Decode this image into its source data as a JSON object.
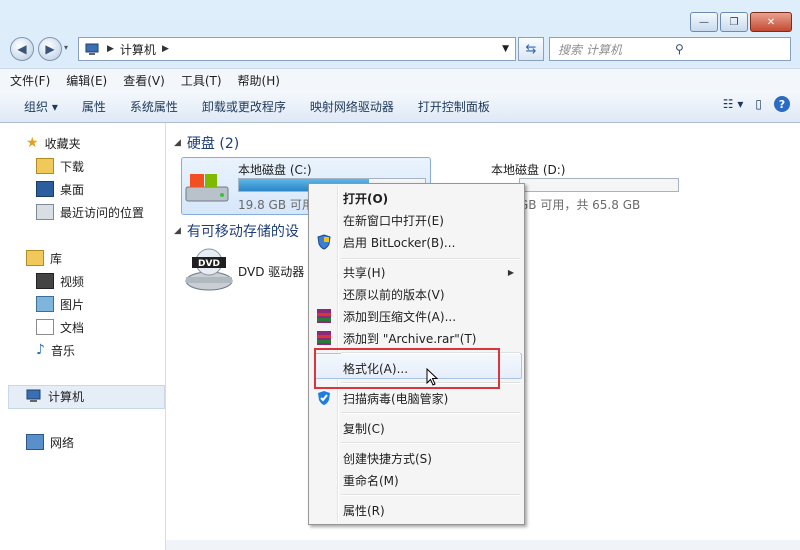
{
  "window": {
    "buttons": {
      "minimize": "—",
      "maximize": "❐",
      "close": "✕"
    }
  },
  "address": {
    "path": "计算机",
    "search_placeholder": "搜索 计算机"
  },
  "menubar": [
    "文件(F)",
    "编辑(E)",
    "查看(V)",
    "工具(T)",
    "帮助(H)"
  ],
  "toolbar": {
    "organize": "组织 ▾",
    "items": [
      "属性",
      "系统属性",
      "卸载或更改程序",
      "映射网络驱动器",
      "打开控制面板"
    ]
  },
  "nav": {
    "favorites": "收藏夹",
    "fav_items": [
      "下载",
      "桌面",
      "最近访问的位置"
    ],
    "library": "库",
    "lib_items": [
      "视频",
      "图片",
      "文档",
      "音乐"
    ],
    "computer": "计算机",
    "network": "网络"
  },
  "content": {
    "hard_disks": "硬盘 (2)",
    "removable": "有可移动存储的设",
    "drive_c": {
      "name": "本地磁盘 (C:)",
      "info": "19.8 GB 可用",
      "used_fraction": 0.7
    },
    "drive_d": {
      "name": "本地磁盘 (D:)",
      "info": "GB 可用，共 65.8 GB",
      "used_fraction": 0.0
    },
    "dvd": {
      "name": "DVD 驱动器",
      "badge": "DVD"
    }
  },
  "context_menu": {
    "open": "打开(O)",
    "open_new": "在新窗口中打开(E)",
    "bitlocker": "启用 BitLocker(B)...",
    "share": "共享(H)",
    "restore": "还原以前的版本(V)",
    "add_archive": "添加到压缩文件(A)...",
    "add_rar": "添加到 \"Archive.rar\"(T)",
    "format": "格式化(A)...",
    "scan": "扫描病毒(电脑管家)",
    "copy": "复制(C)",
    "shortcut": "创建快捷方式(S)",
    "rename": "重命名(M)",
    "properties": "属性(R)"
  }
}
